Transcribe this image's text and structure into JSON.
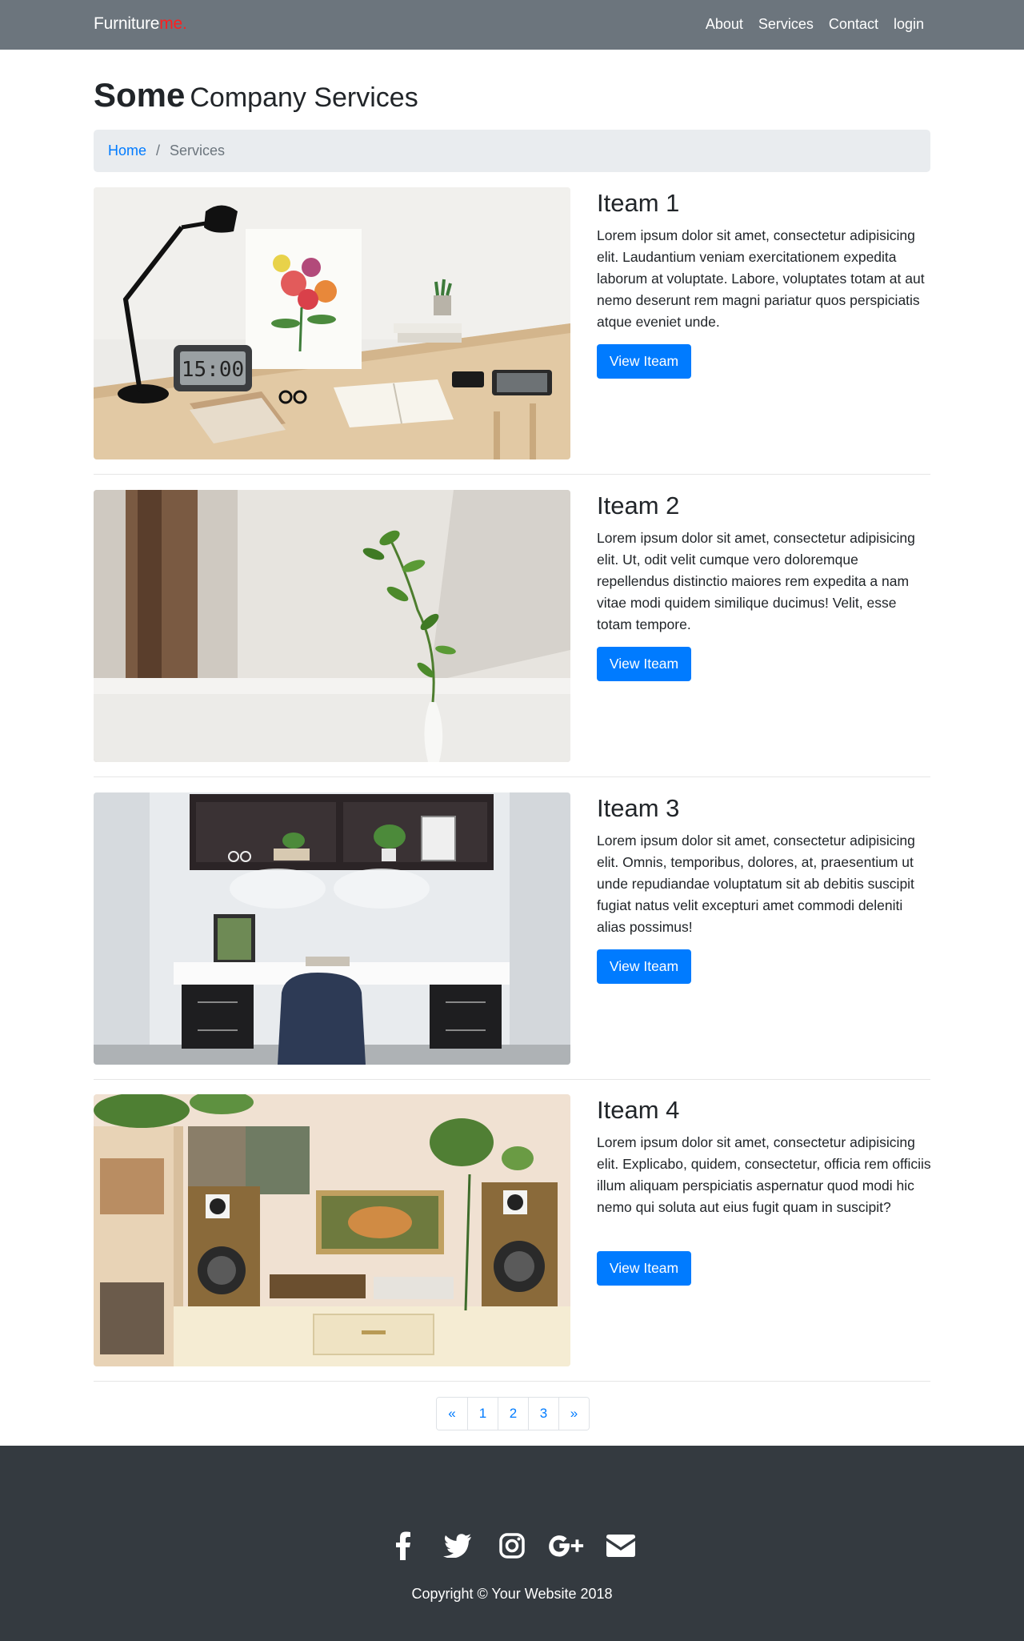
{
  "navbar": {
    "brand_main": "Furniture",
    "brand_accent": "me.",
    "links": [
      "About",
      "Services",
      "Contact",
      "login"
    ]
  },
  "header": {
    "title_strong": "Some",
    "title_light": "Company Services"
  },
  "breadcrumb": {
    "home": "Home",
    "separator": "/",
    "current": "Services"
  },
  "items": [
    {
      "title": "Iteam 1",
      "description": "Lorem ipsum dolor sit amet, consectetur adipisicing elit. Laudantium veniam exercitationem expedita laborum at voluptate. Labore, voluptates totam at aut nemo deserunt rem magni pariatur quos perspiciatis atque eveniet unde.",
      "button": "View Iteam",
      "clock_text": "15:00"
    },
    {
      "title": "Iteam 2",
      "description": "Lorem ipsum dolor sit amet, consectetur adipisicing elit. Ut, odit velit cumque vero doloremque repellendus distinctio maiores rem expedita a nam vitae modi quidem similique ducimus! Velit, esse totam tempore.",
      "button": "View Iteam"
    },
    {
      "title": "Iteam 3",
      "description": "Lorem ipsum dolor sit amet, consectetur adipisicing elit. Omnis, temporibus, dolores, at, praesentium ut unde repudiandae voluptatum sit ab debitis suscipit fugiat natus velit excepturi amet commodi deleniti alias possimus!",
      "button": "View Iteam"
    },
    {
      "title": "Iteam 4",
      "description": "Lorem ipsum dolor sit amet, consectetur adipisicing elit. Explicabo, quidem, consectetur, officia rem officiis illum aliquam perspiciatis aspernatur quod modi hic nemo qui soluta aut eius fugit quam in suscipit?",
      "button": "View Iteam"
    }
  ],
  "pagination": [
    "«",
    "1",
    "2",
    "3",
    "»"
  ],
  "footer": {
    "social_icons": [
      "facebook-icon",
      "twitter-icon",
      "instagram-icon",
      "google-plus-icon",
      "envelope-icon"
    ],
    "copyright": "Copyright © Your Website 2018"
  },
  "colors": {
    "navbar": "#6c757d",
    "brand_accent": "#ff1f1f",
    "primary": "#007bff",
    "breadcrumb_bg": "#e9ecef",
    "footer": "#343a40"
  }
}
